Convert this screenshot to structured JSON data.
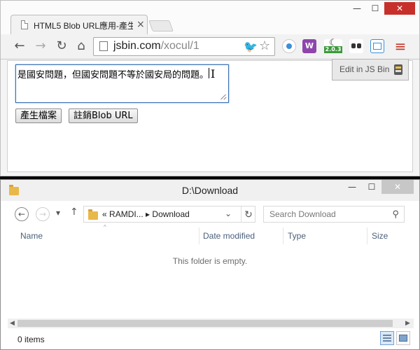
{
  "browser": {
    "tab_title": "HTML5 Blob URL應用-產生",
    "tab_close": "×",
    "win_min": "—",
    "win_max": "☐",
    "win_close": "✕",
    "url_host": "jsbin.com",
    "url_path": "/xocul/1",
    "extension_badge": "2.0.3",
    "nav": {
      "back": "←",
      "forward": "→",
      "reload": "↻",
      "home": "⌂",
      "menu": "≡"
    },
    "icons": {
      "back": "back-arrow-icon",
      "forward": "forward-arrow-icon",
      "reload": "reload-icon",
      "home": "home-icon",
      "twitter": "twitter-bird-icon",
      "star": "bookmark-star-icon",
      "menu": "hamburger-menu-icon"
    },
    "colors": {
      "close": "#c7302a",
      "focus_ring": "#3a6fb0"
    }
  },
  "page": {
    "textarea_value": "是國安問題，但國安問題不等於國安局的問題。",
    "buttons": {
      "generate": "產生檔案",
      "revoke": "註銷Blob URL"
    },
    "jsbin_label": "Edit in JS Bin"
  },
  "explorer": {
    "title": "D:\\Download",
    "win_min": "—",
    "win_max": "☐",
    "win_close": "✕",
    "back": "←",
    "forward": "→",
    "recent_dd": "▾",
    "up": "↑",
    "address": {
      "prefix": "«",
      "crumb1": "RAMDI...",
      "sep": "▸",
      "crumb2": "Download",
      "dropdown": "⌄",
      "refresh": "↻"
    },
    "search_placeholder": "Search Download",
    "search_glyph": "⚲",
    "columns": [
      "Name",
      "Date modified",
      "Type",
      "Size"
    ],
    "sort_glyph": "^",
    "empty_message": "This folder is empty.",
    "scroll_left": "◀",
    "scroll_right": "▶",
    "status": "0 items"
  }
}
